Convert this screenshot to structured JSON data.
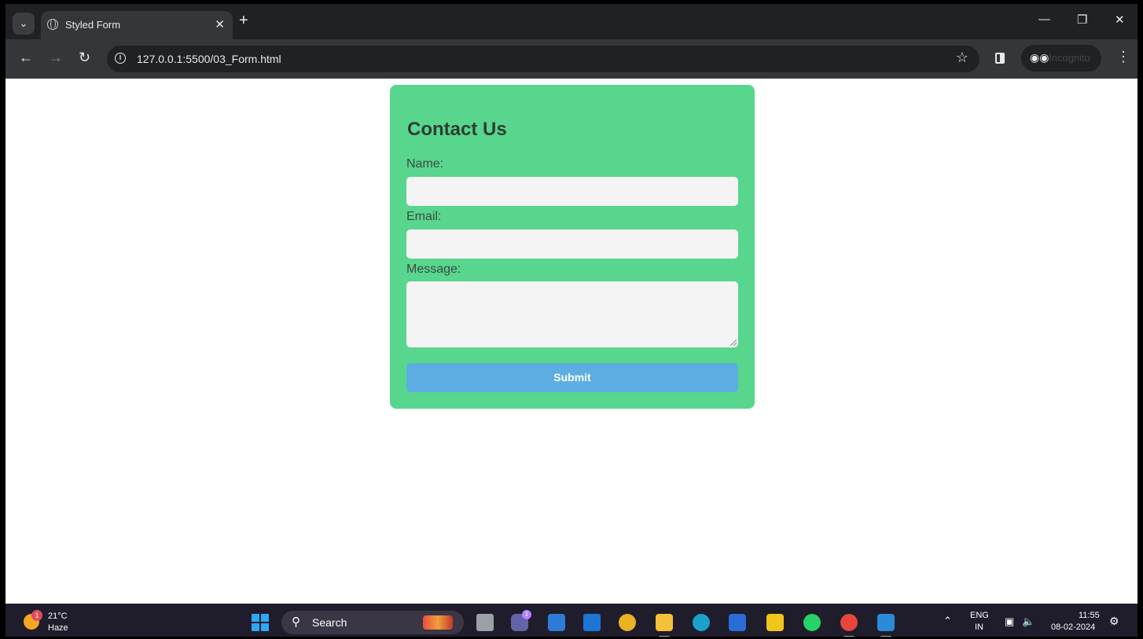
{
  "browser": {
    "tab_title": "Styled Form",
    "url": "127.0.0.1:5500/03_Form.html",
    "incognito_label": "Incognito",
    "icons": [
      "tab-list-icon",
      "globe-icon",
      "close-icon",
      "plus-icon",
      "minimize-icon",
      "restore-icon",
      "back-icon",
      "forward-icon",
      "reload-icon",
      "info-icon",
      "star-icon",
      "side-panel-icon",
      "incognito-icon",
      "menu-icon"
    ]
  },
  "form": {
    "title": "Contact Us",
    "name_label": "Name:",
    "email_label": "Email:",
    "message_label": "Message:",
    "name_value": "",
    "email_value": "",
    "message_value": "",
    "submit_label": "Submit",
    "card_color": "#58d68d",
    "button_color": "#5dade2"
  },
  "taskbar": {
    "weather_temp": "21°C",
    "weather_condition": "Haze",
    "weather_badge": "1",
    "search_label": "Search",
    "teams_badge": "1",
    "language_top": "ENG",
    "language_bottom": "IN",
    "time": "11:55",
    "date": "08-02-2024"
  }
}
